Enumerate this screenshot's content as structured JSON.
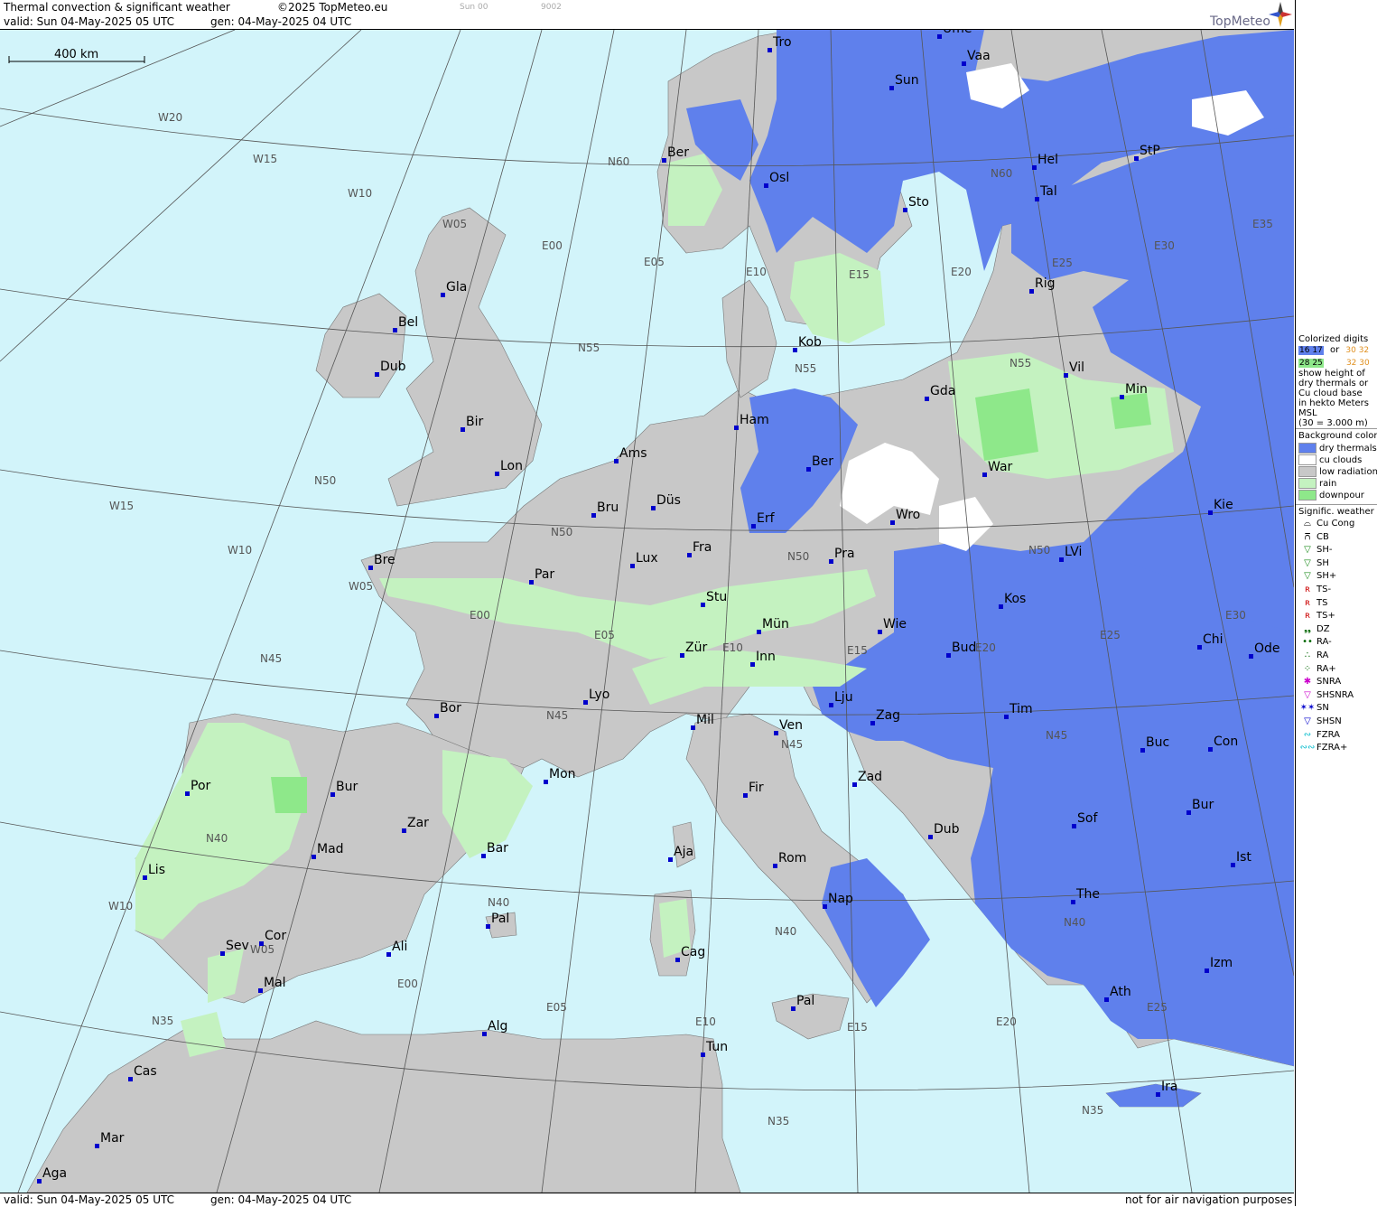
{
  "header": {
    "title": "Thermal convection & significant weather",
    "copyright": "©2025 TopMeteo.eu",
    "faint_left": "Sun 00",
    "faint_right": "9002",
    "valid": "valid:  Sun  04-May-2025  05 UTC",
    "gen": "gen: 04-May-2025 04 UTC",
    "logo": "TopMeteo"
  },
  "footer": {
    "valid": "valid:  Sun  04-May-2025  05 UTC",
    "gen": "gen: 04-May-2025 04 UTC",
    "note": "not for air navigation purposes"
  },
  "scale_label": "400 km",
  "colors": {
    "sea": "#d2f4fa",
    "land_low_radiation": "#c8c8c8",
    "dry_thermals": "#5f80ec",
    "cu_clouds": "#ffffff",
    "rain": "#c4f2c0",
    "downpour": "#8ee88a",
    "city_marker": "#0000cc",
    "grid_line": "#555555"
  },
  "cities": [
    {
      "name": "Tro"
    },
    {
      "name": "Ume"
    },
    {
      "name": "Vaa"
    },
    {
      "name": "Sun"
    },
    {
      "name": "Ber"
    },
    {
      "name": "Osl"
    },
    {
      "name": "Hel"
    },
    {
      "name": "StP"
    },
    {
      "name": "Sto"
    },
    {
      "name": "Tal"
    },
    {
      "name": "Gla"
    },
    {
      "name": "Rig"
    },
    {
      "name": "Bel"
    },
    {
      "name": "Dub"
    },
    {
      "name": "Kob"
    },
    {
      "name": "Vil"
    },
    {
      "name": "Gda"
    },
    {
      "name": "Min"
    },
    {
      "name": "Ham"
    },
    {
      "name": "Bir"
    },
    {
      "name": "Ams"
    },
    {
      "name": "Ber"
    },
    {
      "name": "Lon"
    },
    {
      "name": "War"
    },
    {
      "name": "Düs"
    },
    {
      "name": "Bru"
    },
    {
      "name": "Erf"
    },
    {
      "name": "Wro"
    },
    {
      "name": "Kie"
    },
    {
      "name": "Fra"
    },
    {
      "name": "Lux"
    },
    {
      "name": "Bre"
    },
    {
      "name": "Par"
    },
    {
      "name": "Pra"
    },
    {
      "name": "LVi"
    },
    {
      "name": "Stu"
    },
    {
      "name": "Kos"
    },
    {
      "name": "Mün"
    },
    {
      "name": "Wie"
    },
    {
      "name": "Zür"
    },
    {
      "name": "Inn"
    },
    {
      "name": "Bud"
    },
    {
      "name": "Chi"
    },
    {
      "name": "Ode"
    },
    {
      "name": "Lyo"
    },
    {
      "name": "Lju"
    },
    {
      "name": "Tim"
    },
    {
      "name": "Bor"
    },
    {
      "name": "Mil"
    },
    {
      "name": "Zag"
    },
    {
      "name": "Ven"
    },
    {
      "name": "Buc"
    },
    {
      "name": "Con"
    },
    {
      "name": "Mon"
    },
    {
      "name": "Bur"
    },
    {
      "name": "Por"
    },
    {
      "name": "Fir"
    },
    {
      "name": "Zad"
    },
    {
      "name": "Zar"
    },
    {
      "name": "Bur"
    },
    {
      "name": "Sof"
    },
    {
      "name": "Mad"
    },
    {
      "name": "Bar"
    },
    {
      "name": "Aja"
    },
    {
      "name": "Dub"
    },
    {
      "name": "Rom"
    },
    {
      "name": "Lis"
    },
    {
      "name": "Ist"
    },
    {
      "name": "Nap"
    },
    {
      "name": "The"
    },
    {
      "name": "Pal"
    },
    {
      "name": "Cor"
    },
    {
      "name": "Ali"
    },
    {
      "name": "Sev"
    },
    {
      "name": "Cag"
    },
    {
      "name": "Izm"
    },
    {
      "name": "Mal"
    },
    {
      "name": "Ath"
    },
    {
      "name": "Pal"
    },
    {
      "name": "Alg"
    },
    {
      "name": "Tun"
    },
    {
      "name": "Cas"
    },
    {
      "name": "Ira"
    },
    {
      "name": "Mar"
    },
    {
      "name": "Aga"
    }
  ],
  "grid_labels": [
    "W20",
    "W15",
    "W10",
    "W05",
    "E00",
    "E05",
    "E10",
    "E15",
    "E20",
    "E25",
    "E30",
    "E35",
    "N60",
    "N55",
    "N50",
    "N45",
    "N40",
    "N35",
    "W15",
    "W10",
    "W05",
    "E00",
    "E05",
    "E10",
    "E15",
    "E20",
    "E25",
    "E30",
    "N60",
    "N55",
    "N50",
    "N45",
    "N40",
    "N35",
    "W10",
    "W05",
    "E00",
    "E05",
    "E10",
    "E15",
    "E20",
    "E25",
    "N55",
    "N50",
    "N45",
    "N40",
    "N35",
    "N40",
    "N45",
    "N50"
  ],
  "legend": {
    "colorized_title": "Colorized digits",
    "sample_a": "16 17",
    "sample_or": "or",
    "sample_b": "30 32",
    "sample_c": "28 25",
    "sample_d": "32 30",
    "desc": [
      "show height of",
      "dry thermals or",
      "Cu cloud base",
      "in hekto Meters",
      "MSL",
      "(30 = 3.000 m)"
    ],
    "bg_title": "Background color",
    "bg_items": [
      {
        "label": "dry thermals",
        "color": "#5f80ec"
      },
      {
        "label": "cu clouds",
        "color": "#ffffff"
      },
      {
        "label": "low radiation",
        "color": "#c8c8c8"
      },
      {
        "label": "rain",
        "color": "#c4f2c0"
      },
      {
        "label": "downpour",
        "color": "#8ee88a"
      }
    ],
    "wx_title": "Signific. weather",
    "wx_items": [
      {
        "label": "Cu Cong",
        "icon": "cu-cong-icon",
        "sym": "⌓",
        "color": "#000000"
      },
      {
        "label": "CB",
        "icon": "cb-icon",
        "sym": "⩃",
        "color": "#000000"
      },
      {
        "label": "SH-",
        "icon": "shower-light-icon",
        "sym": "▽",
        "color": "#1a8a1a"
      },
      {
        "label": "SH",
        "icon": "shower-icon",
        "sym": "▽",
        "color": "#1a8a1a"
      },
      {
        "label": "SH+",
        "icon": "shower-heavy-icon",
        "sym": "▽",
        "color": "#1a8a1a"
      },
      {
        "label": "TS-",
        "icon": "thunderstorm-light-icon",
        "sym": "ʀ",
        "color": "#cc0000"
      },
      {
        "label": "TS",
        "icon": "thunderstorm-icon",
        "sym": "ʀ",
        "color": "#cc0000"
      },
      {
        "label": "TS+",
        "icon": "thunderstorm-heavy-icon",
        "sym": "ʀ",
        "color": "#cc0000"
      },
      {
        "label": "DZ",
        "icon": "drizzle-icon",
        "sym": "❟❟",
        "color": "#006600"
      },
      {
        "label": "RA-",
        "icon": "rain-light-icon",
        "sym": "••",
        "color": "#006600"
      },
      {
        "label": "RA",
        "icon": "rain-icon",
        "sym": "∴",
        "color": "#006600"
      },
      {
        "label": "RA+",
        "icon": "rain-heavy-icon",
        "sym": "⁘",
        "color": "#006600"
      },
      {
        "label": "SNRA",
        "icon": "snow-rain-icon",
        "sym": "✱",
        "color": "#cc00cc"
      },
      {
        "label": "SHSNRA",
        "icon": "snow-rain-shower-icon",
        "sym": "▽",
        "color": "#cc00cc"
      },
      {
        "label": "SN",
        "icon": "snow-icon",
        "sym": "✶✶",
        "color": "#0000cc"
      },
      {
        "label": "SHSN",
        "icon": "snow-shower-icon",
        "sym": "▽",
        "color": "#0000cc"
      },
      {
        "label": "FZRA",
        "icon": "freezing-rain-icon",
        "sym": "∾",
        "color": "#00bbcc"
      },
      {
        "label": "FZRA+",
        "icon": "freezing-rain-heavy-icon",
        "sym": "∾∾",
        "color": "#00bbcc"
      }
    ]
  }
}
